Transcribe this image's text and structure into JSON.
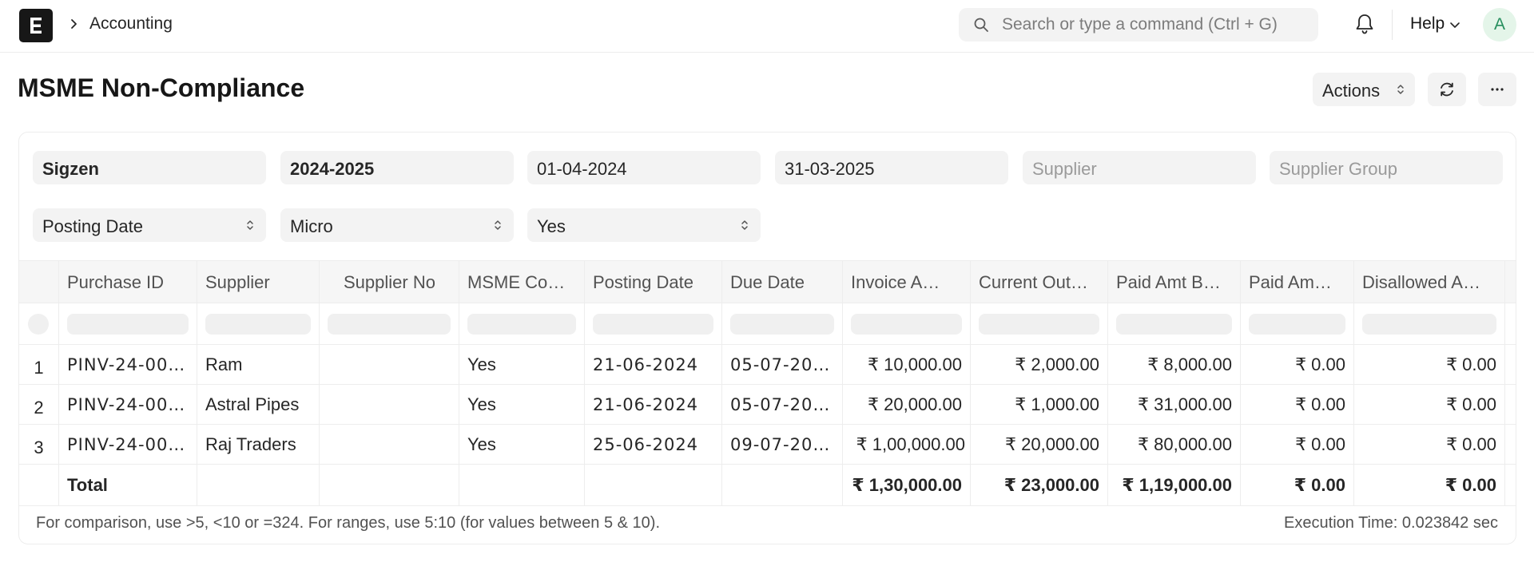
{
  "navbar": {
    "breadcrumb": "Accounting",
    "search_placeholder": "Search or type a command (Ctrl + G)",
    "help_label": "Help",
    "avatar_initial": "A"
  },
  "page": {
    "title": "MSME Non-Compliance",
    "actions_label": "Actions"
  },
  "filters": {
    "company": "Sigzen",
    "fiscal_year": "2024-2025",
    "from_date": "01-04-2024",
    "to_date": "31-03-2025",
    "supplier_placeholder": "Supplier",
    "supplier_group_placeholder": "Supplier Group",
    "date_based_on": "Posting Date",
    "msme_type": "Micro",
    "compliance": "Yes"
  },
  "table": {
    "columns": [
      "Purchase ID",
      "Supplier",
      "Supplier No",
      "MSME Co…",
      "Posting Date",
      "Due Date",
      "Invoice A…",
      "Current Out…",
      "Paid Amt B…",
      "Paid Am…",
      "Disallowed A…"
    ],
    "rows": [
      {
        "idx": "1",
        "purchase_id": "PINV-24-00…",
        "supplier": "Ram",
        "supplier_no": "",
        "msme": "Yes",
        "posting_date": "21-06-2024",
        "due_date": "05-07-20…",
        "invoice": "₹ 10,000.00",
        "current_out": "₹ 2,000.00",
        "paid_b": "₹ 8,000.00",
        "paid_a": "₹ 0.00",
        "disallowed": "₹ 0.00"
      },
      {
        "idx": "2",
        "purchase_id": "PINV-24-00…",
        "supplier": "Astral Pipes",
        "supplier_no": "",
        "msme": "Yes",
        "posting_date": "21-06-2024",
        "due_date": "05-07-20…",
        "invoice": "₹ 20,000.00",
        "current_out": "₹ 1,000.00",
        "paid_b": "₹ 31,000.00",
        "paid_a": "₹ 0.00",
        "disallowed": "₹ 0.00"
      },
      {
        "idx": "3",
        "purchase_id": "PINV-24-00…",
        "supplier": "Raj Traders",
        "supplier_no": "",
        "msme": "Yes",
        "posting_date": "25-06-2024",
        "due_date": "09-07-20…",
        "invoice": "₹ 1,00,000.00",
        "current_out": "₹ 20,000.00",
        "paid_b": "₹ 80,000.00",
        "paid_a": "₹ 0.00",
        "disallowed": "₹ 0.00"
      }
    ],
    "total": {
      "label": "Total",
      "invoice": "₹ 1,30,000.00",
      "current_out": "₹ 23,000.00",
      "paid_b": "₹ 1,19,000.00",
      "paid_a": "₹ 0.00",
      "disallowed": "₹ 0.00"
    }
  },
  "footer": {
    "help_text": "For comparison, use >5, <10 or =324. For ranges, use 5:10 (for values between 5 & 10).",
    "execution_time": "Execution Time: 0.023842 sec"
  }
}
